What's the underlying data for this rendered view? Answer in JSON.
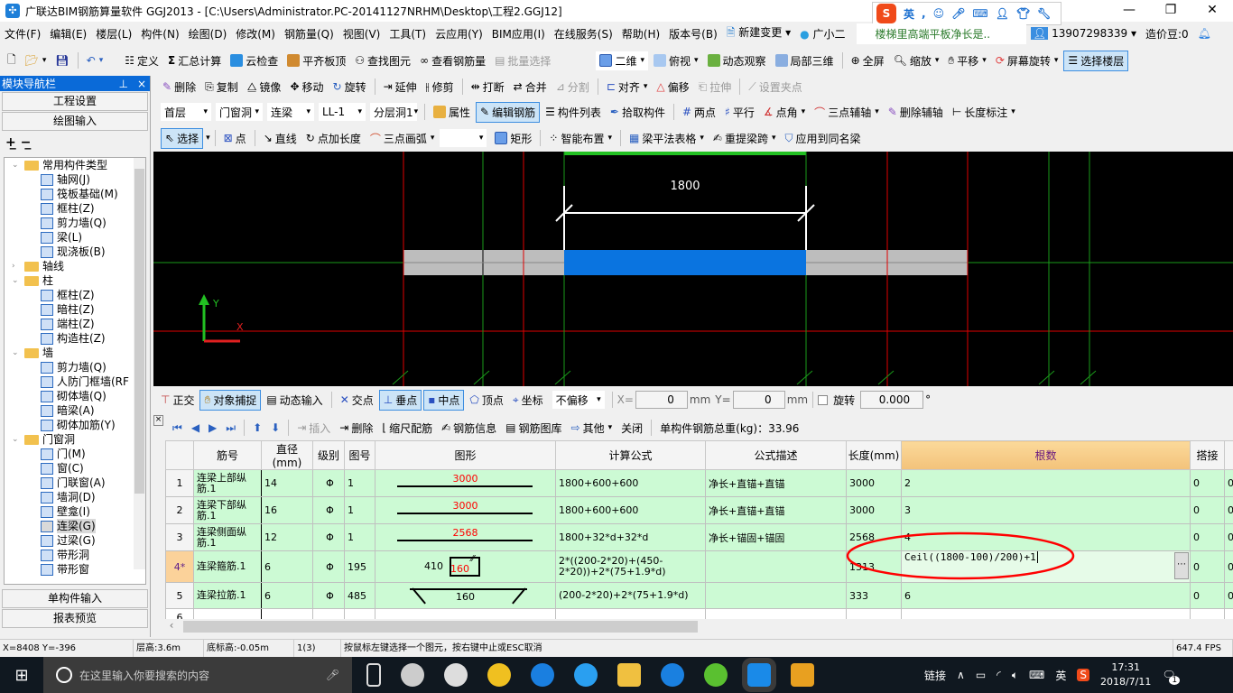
{
  "title": "广联达BIM钢筋算量软件 GGJ2013 - [C:\\Users\\Administrator.PC-20141127NRHM\\Desktop\\工程2.GGJ12]",
  "ime": {
    "lang": "英"
  },
  "menu": [
    "文件(F)",
    "编辑(E)",
    "楼层(L)",
    "构件(N)",
    "绘图(D)",
    "修改(M)",
    "钢筋量(Q)",
    "视图(V)",
    "工具(T)",
    "云应用(Y)",
    "BIM应用(I)",
    "在线服务(S)",
    "帮助(H)",
    "版本号(B)",
    "新建变更",
    "广小二"
  ],
  "news": "楼梯里高端平板净长是..",
  "account": {
    "phone": "13907298339",
    "beans": "造价豆:0"
  },
  "toolbar1": [
    "定义",
    "汇总计算",
    "云检查",
    "平齐板顶",
    "查找图元",
    "查看钢筋量",
    "批量选择",
    "二维",
    "俯视",
    "动态观察",
    "局部三维",
    "全屏",
    "缩放",
    "平移",
    "屏幕旋转",
    "选择楼层"
  ],
  "toolbar2": [
    "删除",
    "复制",
    "镜像",
    "移动",
    "旋转",
    "延伸",
    "修剪",
    "打断",
    "合并",
    "分割",
    "对齐",
    "偏移",
    "拉伸",
    "设置夹点"
  ],
  "toolbar3": {
    "floor": "首层",
    "category": "门窗洞",
    "type": "连梁",
    "component": "LL-1",
    "layer": "分层洞1",
    "buttons": [
      "属性",
      "编辑钢筋",
      "构件列表",
      "拾取构件",
      "两点",
      "平行",
      "点角",
      "三点辅轴",
      "删除辅轴",
      "长度标注"
    ]
  },
  "toolbar4": [
    "选择",
    "点",
    "直线",
    "点加长度",
    "三点画弧",
    "矩形",
    "智能布置",
    "梁平法表格",
    "重提梁跨",
    "应用到同名梁"
  ],
  "sidebar": {
    "title": "模块导航栏",
    "pin": "ᵽ",
    "close": "×",
    "top_buttons": [
      "工程设置",
      "绘图输入"
    ],
    "bottom_buttons": [
      "单构件输入",
      "报表预览"
    ],
    "tree": [
      {
        "label": "常用构件类型",
        "level": 0,
        "folder": true
      },
      {
        "label": "轴网(J)",
        "level": 1
      },
      {
        "label": "筏板基础(M)",
        "level": 1
      },
      {
        "label": "框柱(Z)",
        "level": 1
      },
      {
        "label": "剪力墙(Q)",
        "level": 1
      },
      {
        "label": "梁(L)",
        "level": 1
      },
      {
        "label": "现浇板(B)",
        "level": 1
      },
      {
        "label": "轴线",
        "level": 0,
        "folder": true,
        "collapsed": true
      },
      {
        "label": "柱",
        "level": 0,
        "folder": true
      },
      {
        "label": "框柱(Z)",
        "level": 1
      },
      {
        "label": "暗柱(Z)",
        "level": 1
      },
      {
        "label": "端柱(Z)",
        "level": 1
      },
      {
        "label": "构造柱(Z)",
        "level": 1
      },
      {
        "label": "墙",
        "level": 0,
        "folder": true
      },
      {
        "label": "剪力墙(Q)",
        "level": 1
      },
      {
        "label": "人防门框墙(RF",
        "level": 1
      },
      {
        "label": "砌体墙(Q)",
        "level": 1
      },
      {
        "label": "暗梁(A)",
        "level": 1
      },
      {
        "label": "砌体加筋(Y)",
        "level": 1
      },
      {
        "label": "门窗洞",
        "level": 0,
        "folder": true
      },
      {
        "label": "门(M)",
        "level": 1
      },
      {
        "label": "窗(C)",
        "level": 1
      },
      {
        "label": "门联窗(A)",
        "level": 1
      },
      {
        "label": "墙洞(D)",
        "level": 1
      },
      {
        "label": "壁龛(I)",
        "level": 1
      },
      {
        "label": "连梁(G)",
        "level": 1,
        "selected": true
      },
      {
        "label": "过梁(G)",
        "level": 1
      },
      {
        "label": "带形洞",
        "level": 1
      },
      {
        "label": "带形窗",
        "level": 1
      }
    ]
  },
  "canvas": {
    "dimension": "1800",
    "axis_y": "Y",
    "axis_x": "X"
  },
  "snapbar": {
    "buttons": [
      "正交",
      "对象捕捉",
      "动态输入",
      "交点",
      "垂点",
      "中点",
      "顶点",
      "坐标"
    ],
    "offset_mode": "不偏移",
    "x_label": "X=",
    "x_value": "0",
    "y_label": "Y=",
    "y_value": "0",
    "unit": "mm",
    "rotate_label": "旋转",
    "rotate_value": "0.000",
    "degree": "°"
  },
  "rebarbar": {
    "buttons": [
      "插入",
      "删除",
      "缩尺配筋",
      "钢筋信息",
      "钢筋图库",
      "其他",
      "关闭"
    ],
    "total": "单构件钢筋总重(kg)：33.96"
  },
  "grid": {
    "headers": [
      "",
      "筋号",
      "直径(mm)",
      "级别",
      "图号",
      "图形",
      "计算公式",
      "公式描述",
      "长度(mm)",
      "根数",
      "搭接",
      ""
    ],
    "rows": [
      {
        "n": "1",
        "name": "连梁上部纵筋.1",
        "dia": "14",
        "grade": "Φ",
        "fig": "1",
        "shape_label": "3000",
        "formula": "1800+600+600",
        "desc": "净长+直锚+直锚",
        "length": "3000",
        "count": "2",
        "lap": "0",
        "more": "0"
      },
      {
        "n": "2",
        "name": "连梁下部纵筋.1",
        "dia": "16",
        "grade": "Φ",
        "fig": "1",
        "shape_label": "3000",
        "formula": "1800+600+600",
        "desc": "净长+直锚+直锚",
        "length": "3000",
        "count": "3",
        "lap": "0",
        "more": "0"
      },
      {
        "n": "3",
        "name": "连梁侧面纵筋.1",
        "dia": "12",
        "grade": "Φ",
        "fig": "1",
        "shape_label": "2568",
        "formula": "1800+32*d+32*d",
        "desc": "净长+锚固+锚固",
        "length": "2568",
        "count": "4",
        "lap": "0",
        "more": "0"
      },
      {
        "n": "4*",
        "name": "连梁箍筋.1",
        "dia": "6",
        "grade": "Φ",
        "fig": "195",
        "shape_label": "160",
        "shape_label2": "410",
        "formula": "2*((200-2*20)+(450-2*20))+2*(75+1.9*d)",
        "desc": "",
        "length": "1313",
        "count": "Ceil((1800-100)/200)+1",
        "lap": "0",
        "more": "0"
      },
      {
        "n": "5",
        "name": "连梁拉筋.1",
        "dia": "6",
        "grade": "Φ",
        "fig": "485",
        "shape_label": "160",
        "formula": "(200-2*20)+2*(75+1.9*d)",
        "desc": "",
        "length": "333",
        "count": "6",
        "lap": "0",
        "more": "0"
      },
      {
        "n": "6",
        "name": "",
        "dia": "",
        "grade": "",
        "fig": "",
        "shape_label": "",
        "formula": "",
        "desc": "",
        "length": "",
        "count": "",
        "lap": "",
        "more": ""
      }
    ]
  },
  "status": {
    "coords": "X=8408 Y=-396",
    "floor_height": "层高:3.6m",
    "base_height": "底标高:-0.05m",
    "selection": "1(3)",
    "hint": "按鼠标左键选择一个图元，按右键中止或ESC取消",
    "fps": "647.4 FPS"
  },
  "taskbar": {
    "search_placeholder": "在这里输入你要搜索的内容",
    "tray_link": "链接",
    "tray_lang": "英",
    "time": "17:31",
    "date": "2018/7/11",
    "notifications": "1"
  },
  "colors": {
    "accent": "#0a6ad8",
    "row_bg": "#ccfad4",
    "highlight_header": "#f3c27a",
    "beam_grey": "#bdbdbd",
    "beam_selected": "#0a74e0",
    "annotation_red": "#ff0000"
  }
}
